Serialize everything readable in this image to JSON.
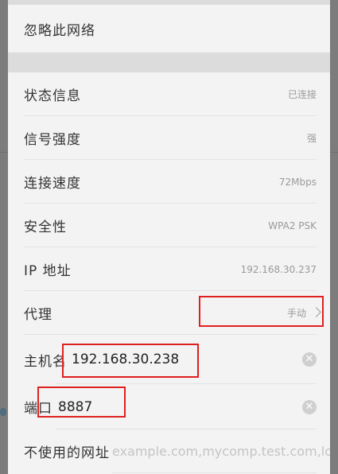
{
  "forget_network": "忽略此网络",
  "info_rows": [
    {
      "label": "状态信息",
      "value": "已连接"
    },
    {
      "label": "信号强度",
      "value": "强"
    },
    {
      "label": "连接速度",
      "value": "72Mbps"
    },
    {
      "label": "安全性",
      "value": "WPA2 PSK"
    },
    {
      "label": "IP 地址",
      "value": "192.168.30.237"
    }
  ],
  "proxy": {
    "label": "代理",
    "value": "手动"
  },
  "hostname": {
    "label": "主机名",
    "value": "192.168.30.238"
  },
  "port": {
    "label": "端口",
    "value": "8887"
  },
  "bypass": {
    "label": "不使用的网址",
    "placeholder": "example.com,mycomp.test.com,localhost"
  },
  "colors": {
    "highlight": "#e02020",
    "panel_bg": "#f3f3f3",
    "divider": "#e3e3e3"
  },
  "icons": {
    "clear": "clear-circle-icon",
    "chevron": "chevron-right-icon"
  }
}
